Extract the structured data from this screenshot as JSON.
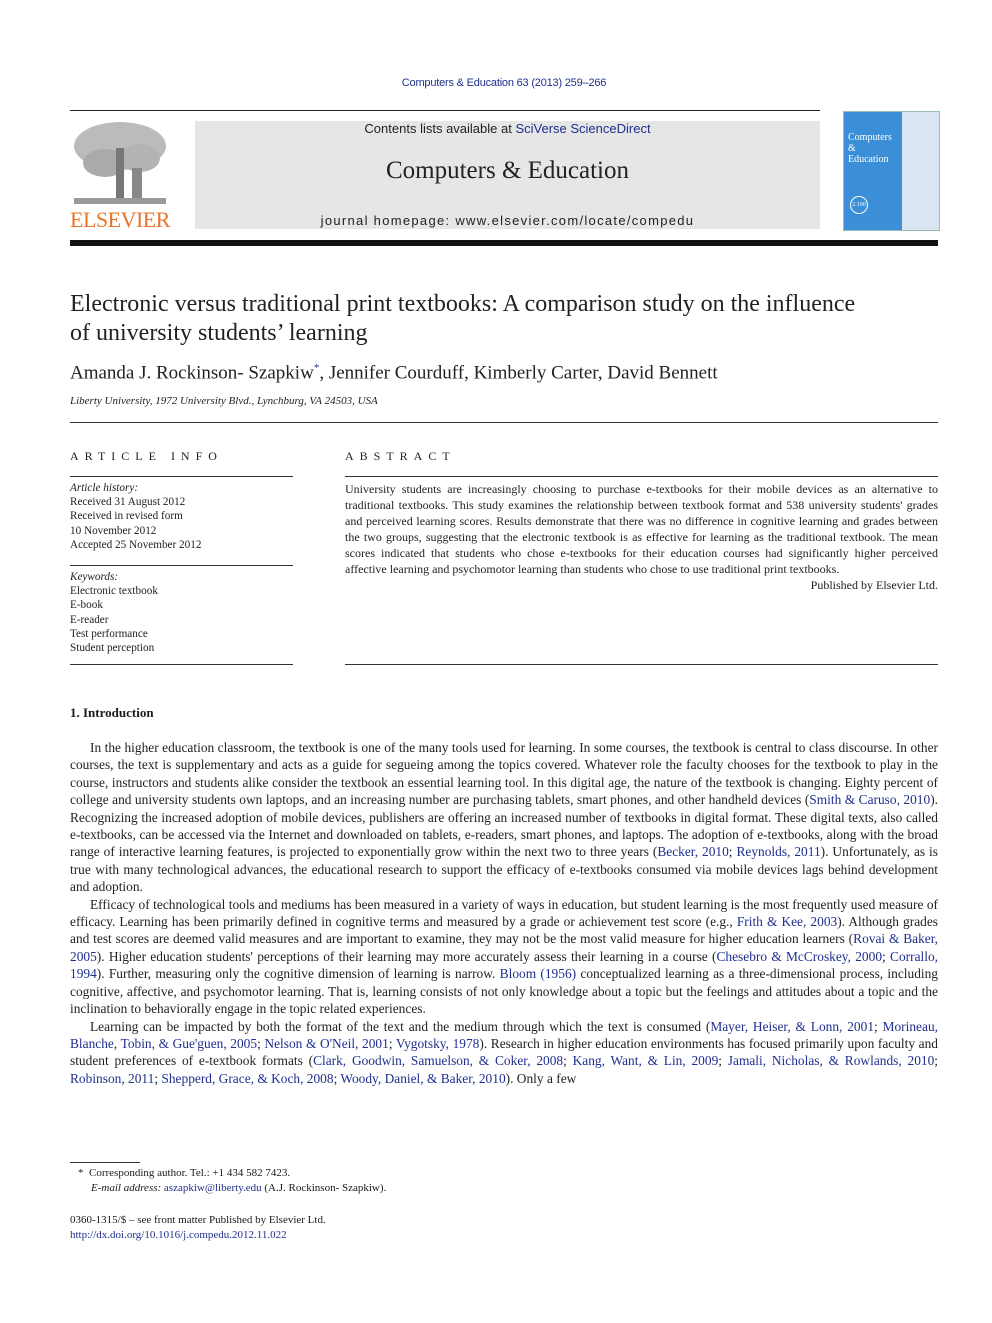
{
  "header": {
    "citation": "Computers & Education 63 (2013) 259–266",
    "contents_prefix": "Contents lists available at ",
    "contents_link": "SciVerse ScienceDirect",
    "journal_name": "Computers & Education",
    "homepage": "journal homepage: www.elsevier.com/locate/compedu",
    "publisher_logo_text": "ELSEVIER",
    "cover_title_line1": "Computers",
    "cover_title_line2": "&",
    "cover_title_line3": "Education",
    "cover_seal": "2.190",
    "brand_color": "#e8742a",
    "link_color": "#1f2f8f",
    "cover_color": "#3a8fd6"
  },
  "article": {
    "title": "Electronic versus traditional print textbooks: A comparison study on the influence of university students’ learning",
    "authors": "Amanda J. Rockinson- Szapkiw",
    "author_mark": "*",
    "authors_rest": ", Jennifer Courduff, Kimberly Carter, David Bennett",
    "affiliation": "Liberty University, 1972 University Blvd., Lynchburg, VA 24503, USA"
  },
  "article_info": {
    "heading": "ARTICLE INFO",
    "history_label": "Article history:",
    "history": [
      "Received 31 August 2012",
      "Received in revised form",
      "10 November 2012",
      "Accepted 25 November 2012"
    ],
    "keywords_label": "Keywords:",
    "keywords": [
      "Electronic textbook",
      "E-book",
      "E-reader",
      "Test performance",
      "Student perception"
    ]
  },
  "abstract": {
    "heading": "ABSTRACT",
    "text": "University students are increasingly choosing to purchase e-textbooks for their mobile devices as an alternative to traditional textbooks. This study examines the relationship between textbook format and 538 university students' grades and perceived learning scores. Results demonstrate that there was no difference in cognitive learning and grades between the two groups, suggesting that the electronic textbook is as effective for learning as the traditional textbook. The mean scores indicated that students who chose e-textbooks for their education courses had significantly higher perceived affective learning and psychomotor learning than students who chose to use traditional print textbooks.",
    "published": "Published by Elsevier Ltd."
  },
  "intro": {
    "heading": "1.  Introduction",
    "p1": [
      {
        "t": "In the higher education classroom, the textbook is one of the many tools used for learning. In some courses, the textbook is central to class discourse. In other courses, the text is supplementary and acts as a guide for segueing among the topics covered. Whatever role the faculty chooses for the textbook to play in the course, instructors and students alike consider the textbook an essential learning tool. In this digital age, the nature of the textbook is changing. Eighty percent of college and university students own laptops, and an increasing number are purchasing tablets, smart phones, and other handheld devices ("
      },
      {
        "t": "Smith & Caruso, 2010",
        "link": true
      },
      {
        "t": "). Recognizing the increased adoption of mobile devices, publishers are offering an increased number of textbooks in digital format. These digital texts, also called e-textbooks, can be accessed via the Internet and downloaded on tablets, e-readers, smart phones, and laptops. The adoption of e-textbooks, along with the broad range of interactive learning features, is projected to exponentially grow within the next two to three years ("
      },
      {
        "t": "Becker, 2010",
        "link": true
      },
      {
        "t": "; "
      },
      {
        "t": "Reynolds, 2011",
        "link": true
      },
      {
        "t": "). Unfortunately, as is true with many technological advances, the educational research to support the efficacy of e-textbooks consumed via mobile devices lags behind development and adoption."
      }
    ],
    "p2": [
      {
        "t": "Efficacy of technological tools and mediums has been measured in a variety of ways in education, but student learning is the most frequently used measure of efficacy. Learning has been primarily defined in cognitive terms and measured by a grade or achievement test score (e.g., "
      },
      {
        "t": "Frith & Kee, 2003",
        "link": true
      },
      {
        "t": "). Although grades and test scores are deemed valid measures and are important to examine, they may not be the most valid measure for higher education learners ("
      },
      {
        "t": "Rovai & Baker, 2005",
        "link": true
      },
      {
        "t": "). Higher education students' perceptions of their learning may more accurately assess their learning in a course ("
      },
      {
        "t": "Chesebro & McCroskey, 2000",
        "link": true
      },
      {
        "t": "; "
      },
      {
        "t": "Corrallo, 1994",
        "link": true
      },
      {
        "t": "). Further, measuring only the cognitive dimension of learning is narrow. "
      },
      {
        "t": "Bloom (1956)",
        "link": true
      },
      {
        "t": " conceptualized learning as a three-dimensional process, including cognitive, affective, and psychomotor learning. That is, learning consists of not only knowledge about a topic but the feelings and attitudes about a topic and the inclination to behaviorally engage in the topic related experiences."
      }
    ],
    "p3": [
      {
        "t": "Learning can be impacted by both the format of the text and the medium through which the text is consumed ("
      },
      {
        "t": "Mayer, Heiser, & Lonn, 2001",
        "link": true
      },
      {
        "t": "; "
      },
      {
        "t": "Morineau, Blanche, Tobin, & Gue'guen, 2005",
        "link": true
      },
      {
        "t": "; "
      },
      {
        "t": "Nelson & O'Neil, 2001",
        "link": true
      },
      {
        "t": "; "
      },
      {
        "t": "Vygotsky, 1978",
        "link": true
      },
      {
        "t": "). Research in higher education environments has focused primarily upon faculty and student preferences of e-textbook formats ("
      },
      {
        "t": "Clark, Goodwin, Samuelson, & Coker, 2008",
        "link": true
      },
      {
        "t": "; "
      },
      {
        "t": "Kang, Want, & Lin, 2009",
        "link": true
      },
      {
        "t": "; "
      },
      {
        "t": "Jamali, Nicholas, & Rowlands, 2010",
        "link": true
      },
      {
        "t": "; "
      },
      {
        "t": "Robinson, 2011",
        "link": true
      },
      {
        "t": "; "
      },
      {
        "t": "Shepperd, Grace, & Koch, 2008",
        "link": true
      },
      {
        "t": "; "
      },
      {
        "t": "Woody, Daniel, & Baker, 2010",
        "link": true
      },
      {
        "t": "). Only a few"
      }
    ]
  },
  "footnote": {
    "mark": "*",
    "corresponding": "Corresponding author. Tel.: +1 434 582 7423.",
    "email_label": "E-mail address: ",
    "email": "aszapkiw@liberty.edu",
    "email_suffix": " (A.J. Rockinson- Szapkiw).",
    "issn": "0360-1315/$ – see front matter Published by Elsevier Ltd.",
    "doi": "http://dx.doi.org/10.1016/j.compedu.2012.11.022"
  }
}
